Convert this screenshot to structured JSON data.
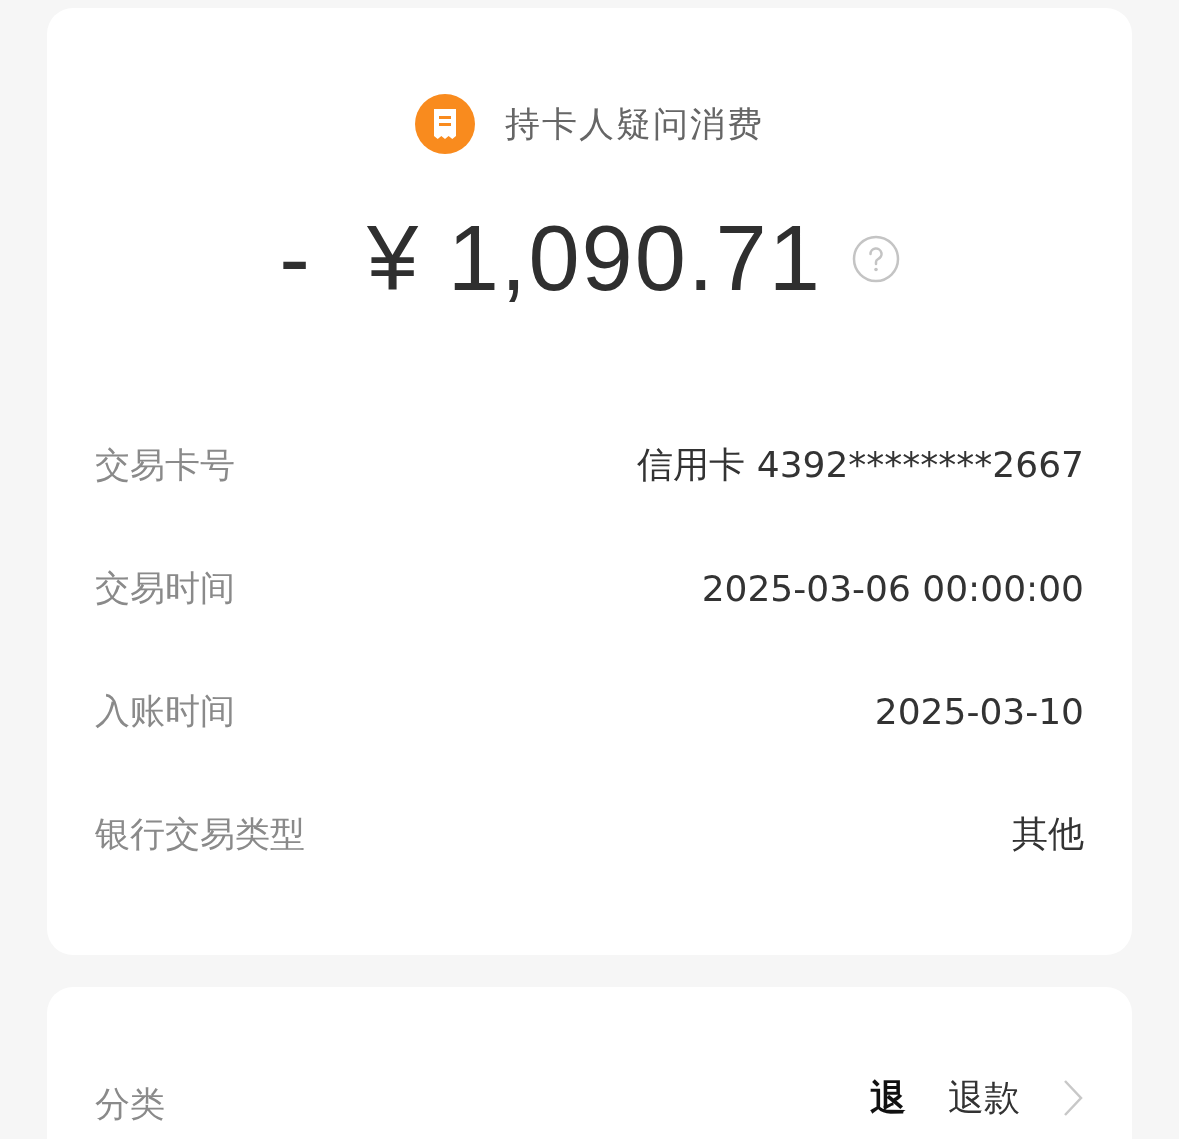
{
  "header": {
    "title": "持卡人疑问消费"
  },
  "amount": {
    "sign": "-",
    "currency": "¥",
    "value": "1,090.71"
  },
  "details": [
    {
      "label": "交易卡号",
      "value": "信用卡 4392********2667"
    },
    {
      "label": "交易时间",
      "value": "2025-03-06 00:00:00"
    },
    {
      "label": "入账时间",
      "value": "2025-03-10"
    },
    {
      "label": "银行交易类型",
      "value": "其他"
    }
  ],
  "category": {
    "label": "分类",
    "badge": "退",
    "value": "退款"
  }
}
